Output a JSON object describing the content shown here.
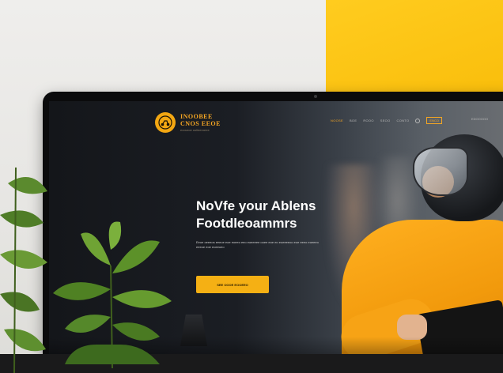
{
  "colors": {
    "accent": "#f5a623",
    "button": "#f5b014",
    "wall_yellow": "#fbc412",
    "screen_dark": "#14161a",
    "rider_orange": "#f29a0c"
  },
  "site": {
    "logo": {
      "icon": "scooter-logo-icon",
      "line1": "INOOBEE",
      "line2": "CNOS EEOE",
      "tagline": "eoouroe oolleeroeee"
    },
    "nav": {
      "items": [
        "NOOSE",
        "BOE",
        "ROOO",
        "SEOO",
        "CONTO"
      ],
      "active_index": 0,
      "search_icon": "search-icon",
      "cta": "ENCO",
      "right": "EDOOOOO"
    },
    "hero": {
      "title_line1": "NoVfe your Ablens",
      "title_line2": "Footdleoammrs",
      "description": "Eeoe oeeeos eeeoe eoe eoeeo eeo eoeeeee ooee eoe eo eoeeeeoo eoe eeeo eoeeeo eeeoe eoe eoeeoeo",
      "button_label": "SEE OOOE EOOEEO"
    }
  }
}
